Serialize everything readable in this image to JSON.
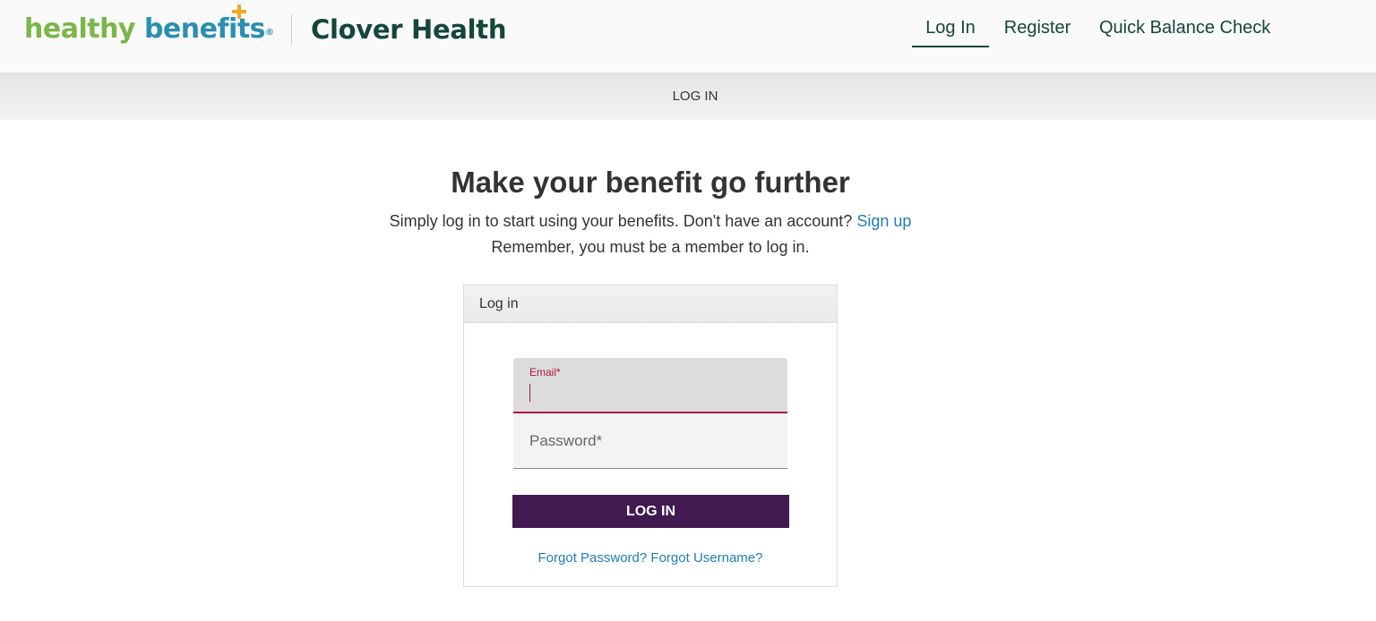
{
  "brand": {
    "logo_word1": "healthy",
    "logo_word2": "benefits",
    "logo_registered": "®",
    "partner_name": "Clover Health",
    "colors": {
      "green": "#7ab648",
      "blue": "#2b8fb3",
      "orange": "#f2a623",
      "clover_dark_green": "#14463a",
      "button_purple": "#411a52",
      "link_blue": "#1e7eb8",
      "error_red": "#b0123f"
    }
  },
  "nav": {
    "items": [
      {
        "label": "Log In",
        "active": true
      },
      {
        "label": "Register",
        "active": false
      },
      {
        "label": "Quick Balance Check",
        "active": false
      }
    ]
  },
  "subbar": {
    "title": "LOG IN"
  },
  "main": {
    "headline": "Make your benefit go further",
    "subtext_line1": "Simply log in to start using your benefits. Don't have an account?",
    "signup_link": "Sign up",
    "subtext_line2": "Remember, you must be a member to log in."
  },
  "login_card": {
    "header": "Log in",
    "email_label": "Email*",
    "email_value": "",
    "password_placeholder": "Password*",
    "password_value": "",
    "submit_label": "LOG IN",
    "forgot_password": "Forgot Password?",
    "forgot_username": "Forgot Username?"
  },
  "icons": {
    "logo_accent": "plus-icon"
  }
}
